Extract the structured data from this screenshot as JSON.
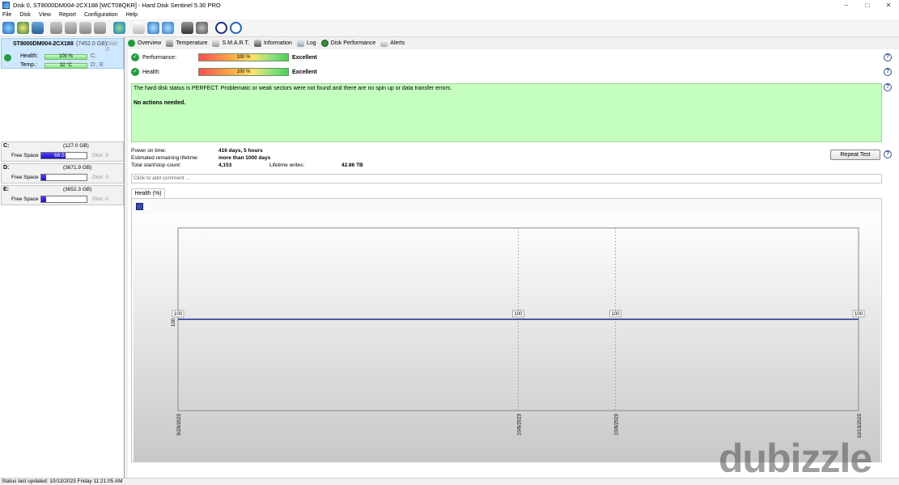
{
  "window": {
    "title": "Disk 0, ST8000DM004-2CX188 [WCT08QKR]  -  Hard Disk Sentinel 5.30 PRO",
    "controls": [
      "‒",
      "□",
      "✕"
    ]
  },
  "menu": [
    "File",
    "Disk",
    "View",
    "Report",
    "Configuration",
    "Help"
  ],
  "disk": {
    "name": "ST8000DM004-2CX188",
    "size": "(7452.0 GB)",
    "index": "Disk: 0",
    "health_label": "Health:",
    "health_value": "100 %",
    "health_drive": "C:",
    "temp_label": "Temp.:",
    "temp_value": "32 °C",
    "temp_drives": "D:, E:"
  },
  "volumes": [
    {
      "letter": "C:",
      "size": "(127.0 GB)",
      "free_label": "Free Space",
      "free": "68.5 GB",
      "free_fraction": 0.54,
      "disk": "Disk: 0"
    },
    {
      "letter": "D:",
      "size": "(3671.9 GB)",
      "free_label": "Free Space",
      "free": "359.1 GB",
      "free_fraction": 0.1,
      "disk": "Disk: 0"
    },
    {
      "letter": "E:",
      "size": "(3652.3 GB)",
      "free_label": "Free Space",
      "free": "410.1 GB",
      "free_fraction": 0.11,
      "disk": "Disk: 0"
    }
  ],
  "tabs": [
    "Overview",
    "Temperature",
    "S.M.A.R.T.",
    "Information",
    "Log",
    "Disk Performance",
    "Alerts"
  ],
  "overview": {
    "performance_label": "Performance:",
    "performance_value": "100 %",
    "performance_result": "Excellent",
    "health_label": "Health:",
    "health_value": "100 %",
    "health_result": "Excellent",
    "status_text": "The hard disk status is PERFECT. Problematic or weak sectors were not found and there are no spin up or data transfer errors.",
    "status_action": "No actions needed.",
    "power_on_label": "Power on time:",
    "power_on_value": "416 days, 5 hours",
    "lifetime_label": "Estimated remaining lifetime:",
    "lifetime_value": "more than 1000 days",
    "start_stop_label": "Total start/stop count:",
    "start_stop_value": "4,153",
    "writes_label": "Lifetime writes:",
    "writes_value": "42.86 TB",
    "repeat_button": "Repeat Test",
    "comment_placeholder": "Click to add comment ...",
    "chart_tab": "Health (%)",
    "help": "?"
  },
  "chart_data": {
    "type": "line",
    "title": "",
    "xlabel": "",
    "ylabel": "",
    "x": [
      "9/29/2023",
      "10/6/2023",
      "10/8/2023",
      "10/13/2023"
    ],
    "series": [
      {
        "values": [
          100,
          100,
          100,
          100
        ]
      }
    ],
    "ylim": [
      0,
      200
    ],
    "y_tick": "100",
    "grid": true,
    "color": "#1c2a8c"
  },
  "statusbar": "Status last updated: 10/13/2023 Friday 11:21:05 AM",
  "watermark": "dubizzle"
}
